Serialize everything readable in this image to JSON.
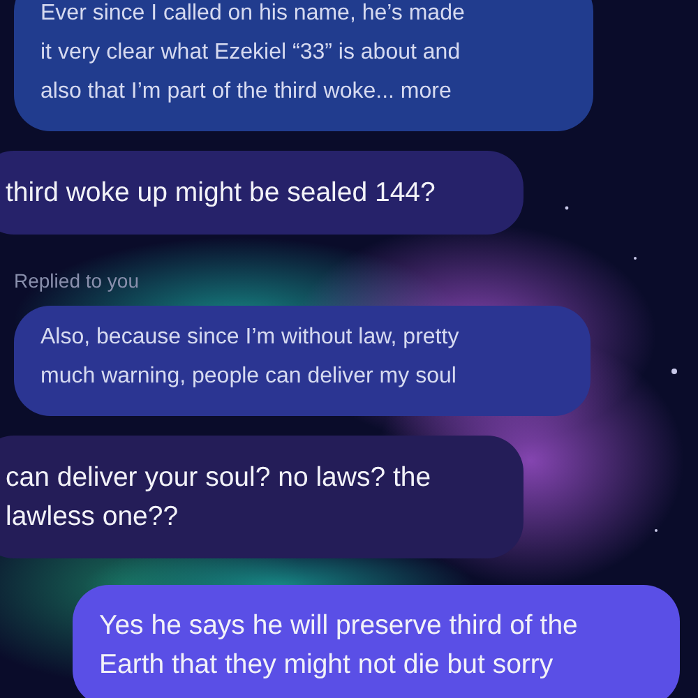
{
  "messages": [
    {
      "kind": "quoted",
      "text": "Ever since I called on his name, he’s made\nit very clear what Ezekiel “33” is about and\nalso that I’m part of the third woke... more"
    },
    {
      "kind": "received",
      "text": "third woke up might be sealed 144?"
    },
    {
      "kind": "reply_label",
      "text": "Replied to you"
    },
    {
      "kind": "quoted",
      "text": "Also, because since I’m without law, pretty\nmuch warning, people can deliver my soul"
    },
    {
      "kind": "received",
      "text": "can deliver your soul? no laws? the\nlawless one??"
    },
    {
      "kind": "sent",
      "text": "Yes he says he will preserve third of the\nEarth that they might not die but sorry"
    }
  ]
}
